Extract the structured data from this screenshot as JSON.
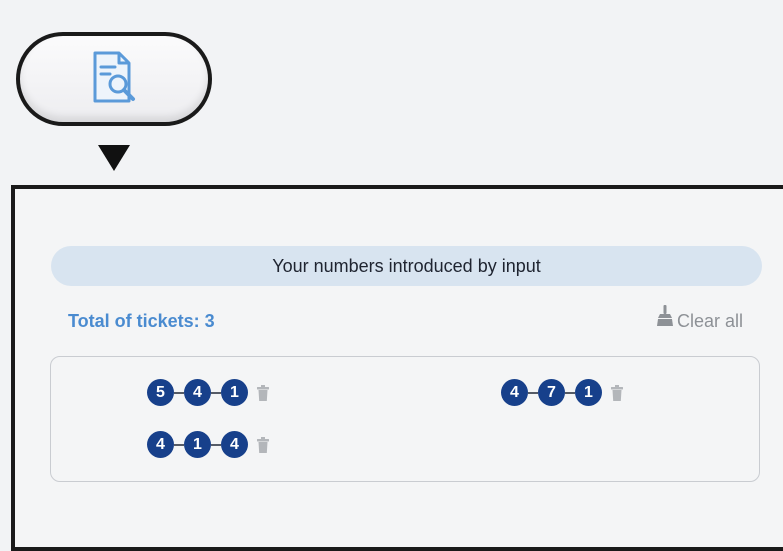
{
  "toolbar": {
    "view_icon": "document-search-icon"
  },
  "panel": {
    "header": "Your numbers introduced by input",
    "total_label": "Total of tickets: 3",
    "clear_all_label": "Clear all",
    "clear_all_icon": "broom-icon"
  },
  "tickets": [
    {
      "numbers": [
        "5",
        "4",
        "1"
      ]
    },
    {
      "numbers": [
        "4",
        "7",
        "1"
      ]
    },
    {
      "numbers": [
        "4",
        "1",
        "4"
      ]
    }
  ],
  "colors": {
    "ball": "#17408b",
    "header_bar": "#d8e4f0",
    "total_text": "#4a8bd0",
    "icon_blue": "#5b9ad9",
    "muted_grey": "#8d9196"
  }
}
